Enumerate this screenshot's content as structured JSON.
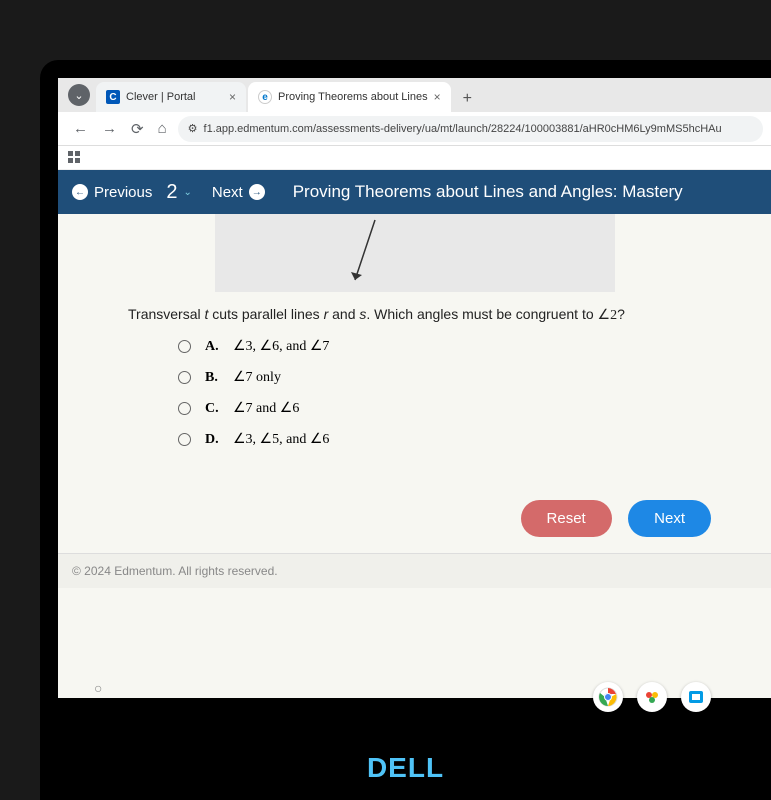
{
  "tabs": {
    "launcher_glyph": "⌄",
    "items": [
      {
        "favicon_letter": "C",
        "title": "Clever | Portal"
      },
      {
        "favicon_letter": "e",
        "title": "Proving Theorems about Lines"
      }
    ],
    "new_tab": "+"
  },
  "nav": {
    "back": "←",
    "forward": "→",
    "reload": "⟳",
    "home": "⌂",
    "lock": "⚙",
    "url": "f1.app.edmentum.com/assessments-delivery/ua/mt/launch/28224/100003881/aHR0cHM6Ly9mMS5hcHAu"
  },
  "bluebar": {
    "prev_arrow": "←",
    "prev_label": "Previous",
    "question_number": "2",
    "caret": "⌄",
    "next_label": "Next",
    "next_arrow": "→",
    "title": "Proving Theorems about Lines and Angles: Mastery"
  },
  "question": {
    "text_before": "Transversal ",
    "var_t": "t",
    "text_mid1": " cuts parallel lines ",
    "var_r": "r",
    "text_mid2": " and ",
    "var_s": "s",
    "text_mid3": ". Which angles must be congruent to ",
    "angle2": "∠2",
    "text_after": "?"
  },
  "options": [
    {
      "letter": "A.",
      "text": "∠3, ∠6, and ∠7"
    },
    {
      "letter": "B.",
      "text": "∠7 only"
    },
    {
      "letter": "C.",
      "text": "∠7 and ∠6"
    },
    {
      "letter": "D.",
      "text": "∠3, ∠5, and ∠6"
    }
  ],
  "buttons": {
    "reset": "Reset",
    "next": "Next"
  },
  "footer": "© 2024 Edmentum. All rights reserved.",
  "shelf_hollow": "○",
  "brand": "DELL"
}
